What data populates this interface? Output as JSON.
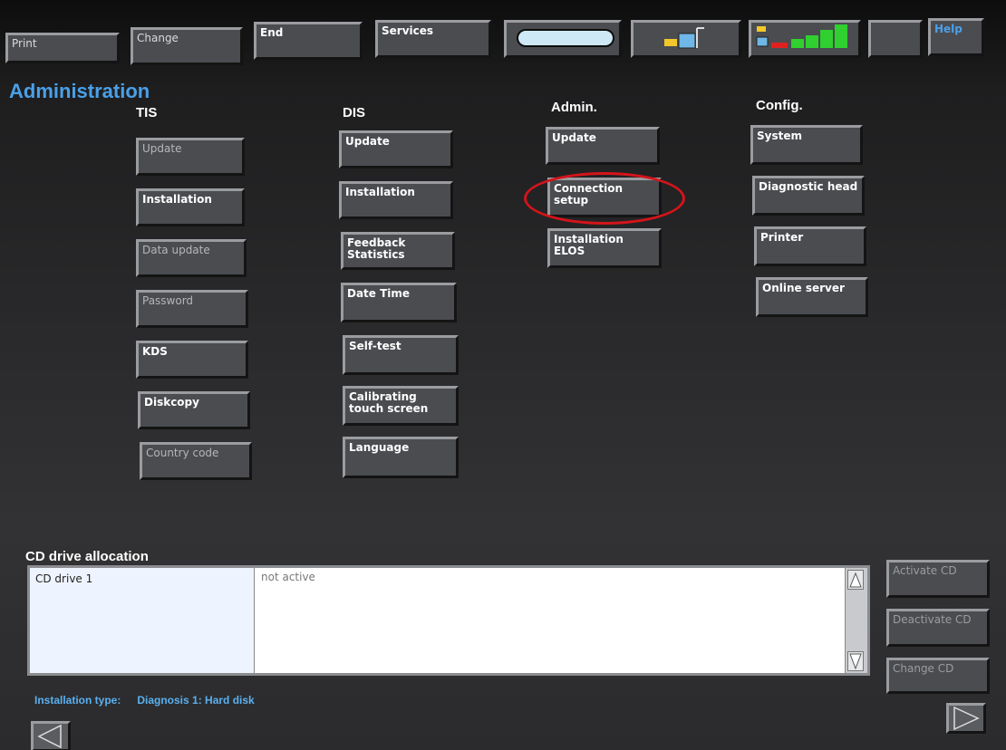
{
  "toolbar": {
    "print": "Print",
    "change": "Change",
    "end": "End",
    "services": "Services",
    "help": "Help",
    "icons": [
      "cd-drive-icon",
      "connection-icon",
      "signal-strength-icon"
    ]
  },
  "title": "Administration",
  "columns": {
    "tis": {
      "heading": "TIS",
      "buttons": [
        "Update",
        "Installation",
        "Data update",
        "Password",
        "KDS",
        "Diskcopy",
        "Country code"
      ]
    },
    "dis": {
      "heading": "DIS",
      "buttons": [
        "Update",
        "Installation",
        "Feedback Statistics",
        "Date Time",
        "Self-test",
        "Calibrating touch screen",
        "Language"
      ]
    },
    "admin": {
      "heading": "Admin.",
      "buttons": [
        "Update",
        "Connection setup",
        "Installation ELOS"
      ]
    },
    "config": {
      "heading": "Config.",
      "buttons": [
        "System",
        "Diagnostic head",
        "Printer",
        "Online server"
      ]
    }
  },
  "cd": {
    "title": "CD drive allocation",
    "drive": "CD drive 1",
    "status": "not active",
    "buttons": [
      "Activate CD",
      "Deactivate CD",
      "Change CD"
    ]
  },
  "status": {
    "label": "Installation type:",
    "value": "Diagnosis 1: Hard disk"
  },
  "accent": "#4aa0e8",
  "highlight": "#d4141a"
}
